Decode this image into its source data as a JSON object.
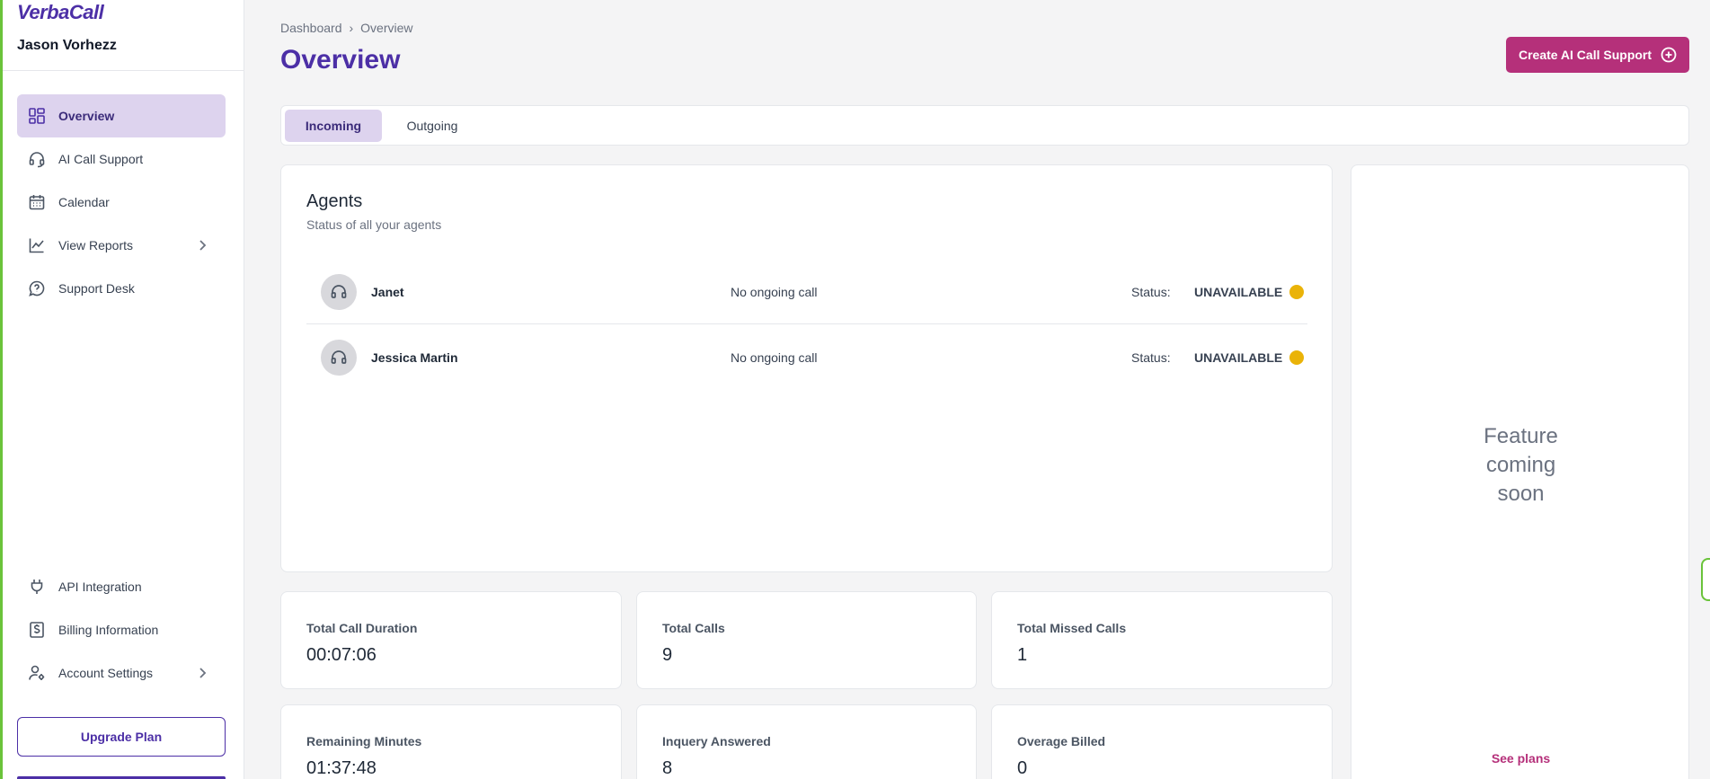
{
  "brand": {
    "name": "VerbaCall"
  },
  "user": {
    "name": "Jason Vorhezz"
  },
  "sidebar": {
    "items": [
      {
        "label": "Overview",
        "icon": "grid-icon",
        "active": true
      },
      {
        "label": "AI Call Support",
        "icon": "headset-icon"
      },
      {
        "label": "Calendar",
        "icon": "calendar-icon"
      },
      {
        "label": "View Reports",
        "icon": "chart-line-icon",
        "has_submenu": true
      },
      {
        "label": "Support Desk",
        "icon": "chat-help-icon"
      }
    ],
    "bottom_items": [
      {
        "label": "API Integration",
        "icon": "plug-icon"
      },
      {
        "label": "Billing Information",
        "icon": "dollar-doc-icon"
      },
      {
        "label": "Account Settings",
        "icon": "user-gear-icon",
        "has_submenu": true
      }
    ],
    "upgrade_label": "Upgrade Plan"
  },
  "breadcrumb": {
    "root": "Dashboard",
    "current": "Overview"
  },
  "header": {
    "title": "Overview",
    "create_button": "Create AI Call Support"
  },
  "tabs": [
    {
      "label": "Incoming",
      "active": true
    },
    {
      "label": "Outgoing"
    }
  ],
  "agents": {
    "title": "Agents",
    "subtitle": "Status of all your agents",
    "status_label": "Status:",
    "list": [
      {
        "name": "Janet",
        "call": "No ongoing call",
        "status": "UNAVAILABLE",
        "status_color": "#eab308"
      },
      {
        "name": "Jessica Martin",
        "call": "No ongoing call",
        "status": "UNAVAILABLE",
        "status_color": "#eab308"
      }
    ]
  },
  "stats": [
    {
      "label": "Total Call Duration",
      "value": "00:07:06"
    },
    {
      "label": "Total Calls",
      "value": "9"
    },
    {
      "label": "Total Missed Calls",
      "value": "1"
    },
    {
      "label": "Remaining Minutes",
      "value": "01:37:48"
    },
    {
      "label": "Inquery Answered",
      "value": "8"
    },
    {
      "label": "Overage Billed",
      "value": "0"
    }
  ],
  "feature_panel": {
    "line1": "Feature",
    "line2": "coming",
    "line3": "soon",
    "link": "See plans"
  },
  "colors": {
    "accent": "#4c2fa6",
    "cta": "#b5307a",
    "active_bg": "#ddd3ee",
    "status_unavailable": "#eab308"
  }
}
